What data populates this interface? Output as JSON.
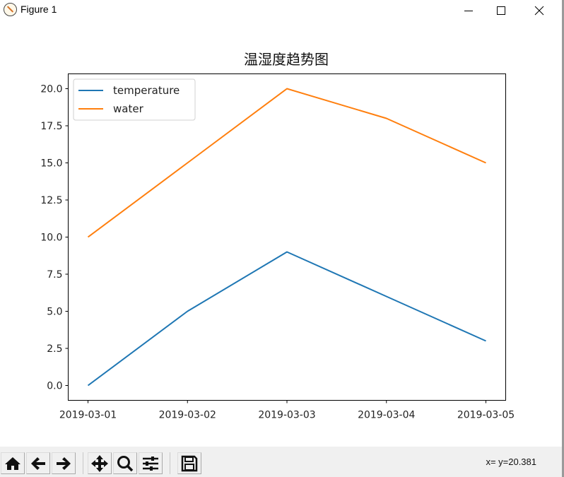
{
  "window": {
    "title": "Figure 1",
    "buttons": {
      "minimize": "minimize",
      "maximize": "maximize",
      "close": "close"
    }
  },
  "toolbar": {
    "buttons": [
      {
        "name": "home",
        "icon": "home-icon"
      },
      {
        "name": "back",
        "icon": "arrow-left-icon"
      },
      {
        "name": "forward",
        "icon": "arrow-right-icon"
      },
      {
        "name": "pan",
        "icon": "move-icon"
      },
      {
        "name": "zoom",
        "icon": "magnifier-icon"
      },
      {
        "name": "configure-subplots",
        "icon": "sliders-icon"
      },
      {
        "name": "save",
        "icon": "floppy-disk-icon"
      }
    ],
    "coordinates": "x= y=20.381"
  },
  "colors": {
    "temperature": "#1f77b4",
    "water": "#ff7f0e"
  },
  "chart_data": {
    "type": "line",
    "title": "温湿度趋势图",
    "xlabel": "",
    "ylabel": "",
    "x": [
      "2019-03-01",
      "2019-03-02",
      "2019-03-03",
      "2019-03-04",
      "2019-03-05"
    ],
    "series": [
      {
        "name": "temperature",
        "values": [
          0,
          5,
          9,
          6,
          3
        ]
      },
      {
        "name": "water",
        "values": [
          10,
          15,
          20,
          18,
          15
        ]
      }
    ],
    "ylim": [
      -1,
      21
    ],
    "yticks": [
      "0.0",
      "2.5",
      "5.0",
      "7.5",
      "10.0",
      "12.5",
      "15.0",
      "17.5",
      "20.0"
    ],
    "ytick_values": [
      0,
      2.5,
      5,
      7.5,
      10,
      12.5,
      15,
      17.5,
      20
    ],
    "grid": false,
    "legend": "top-left"
  }
}
